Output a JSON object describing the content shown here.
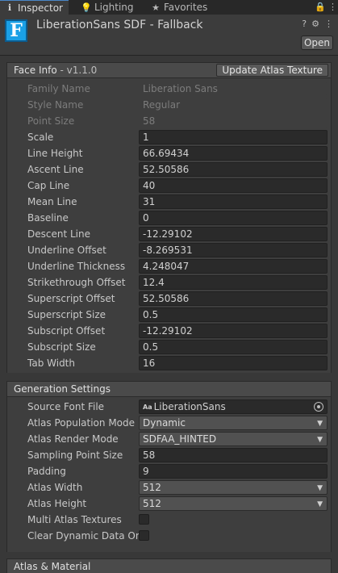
{
  "tabs": [
    {
      "label": "Inspector",
      "icon": "info-icon",
      "glyph": "ℹ"
    },
    {
      "label": "Lighting",
      "icon": "lightbulb-icon",
      "glyph": "💡"
    },
    {
      "label": "Favorites",
      "icon": "star-icon",
      "glyph": "★"
    }
  ],
  "window_controls": {
    "lock_glyph": "🔒",
    "menu_glyph": "⋮"
  },
  "header": {
    "icon_letter": "F",
    "title": "LiberationSans SDF - Fallback",
    "help_glyph": "?",
    "settings_glyph": "⚙",
    "more_glyph": "⋮",
    "open_label": "Open"
  },
  "face_info": {
    "title": "Face Info",
    "version": "- v1.1.0",
    "update_button": "Update Atlas Texture",
    "rows": [
      {
        "label": "Family Name",
        "value": "Liberation Sans",
        "readonly": true
      },
      {
        "label": "Style Name",
        "value": "Regular",
        "readonly": true
      },
      {
        "label": "Point Size",
        "value": "58",
        "readonly": true
      },
      {
        "label": "Scale",
        "value": "1"
      },
      {
        "label": "Line Height",
        "value": "66.69434"
      },
      {
        "label": "Ascent Line",
        "value": "52.50586"
      },
      {
        "label": "Cap Line",
        "value": "40"
      },
      {
        "label": "Mean Line",
        "value": "31"
      },
      {
        "label": "Baseline",
        "value": "0"
      },
      {
        "label": "Descent Line",
        "value": "-12.29102"
      },
      {
        "label": "Underline Offset",
        "value": "-8.269531"
      },
      {
        "label": "Underline Thickness",
        "value": "4.248047"
      },
      {
        "label": "Strikethrough Offset",
        "value": "12.4"
      },
      {
        "label": "Superscript Offset",
        "value": "52.50586"
      },
      {
        "label": "Superscript Size",
        "value": "0.5"
      },
      {
        "label": "Subscript Offset",
        "value": "-12.29102"
      },
      {
        "label": "Subscript Size",
        "value": "0.5"
      },
      {
        "label": "Tab Width",
        "value": "16"
      }
    ]
  },
  "generation_settings": {
    "title": "Generation Settings",
    "source_font_file": {
      "label": "Source Font File",
      "value": "LiberationSans",
      "badge": "Aa"
    },
    "atlas_population_mode": {
      "label": "Atlas Population Mode",
      "value": "Dynamic"
    },
    "atlas_render_mode": {
      "label": "Atlas Render Mode",
      "value": "SDFAA_HINTED"
    },
    "sampling_point_size": {
      "label": "Sampling Point Size",
      "value": "58"
    },
    "padding": {
      "label": "Padding",
      "value": "9"
    },
    "atlas_width": {
      "label": "Atlas Width",
      "value": "512"
    },
    "atlas_height": {
      "label": "Atlas Height",
      "value": "512"
    },
    "multi_atlas_textures": {
      "label": "Multi Atlas Textures",
      "checked": false
    },
    "clear_dynamic_data": {
      "label": "Clear Dynamic Data On",
      "checked": false
    }
  },
  "atlas_material": {
    "title": "Atlas & Material"
  }
}
